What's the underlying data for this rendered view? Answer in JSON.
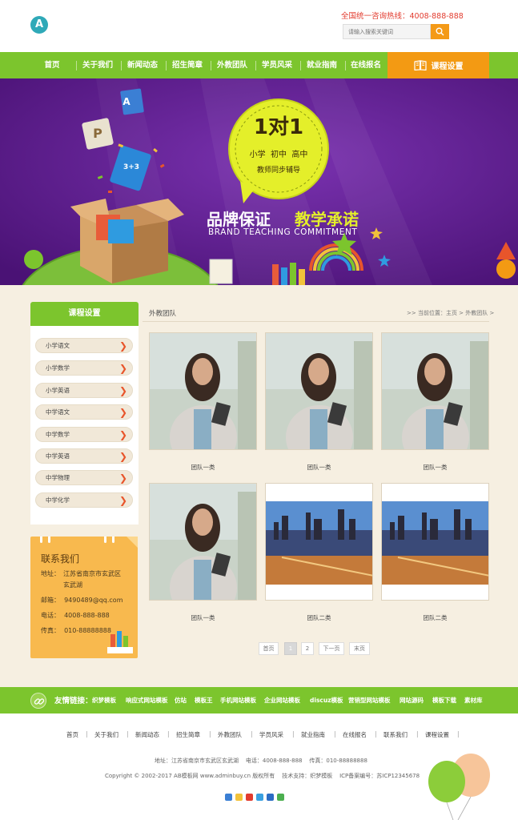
{
  "header": {
    "logo_letter": "A",
    "hotline": "全国统一咨询热线：4008-888-888",
    "search_placeholder": "请输入搜索关键词"
  },
  "nav": {
    "items": [
      "首页",
      "关于我们",
      "新闻动态",
      "招生简章",
      "外教团队",
      "学员风采",
      "就业指南",
      "在线报名"
    ],
    "course": "课程设置"
  },
  "banner": {
    "badge_big": "1对1",
    "badge_levels": "小学  初中  高中",
    "badge_sub": "教师同步辅导",
    "slogan_left": "品牌保证",
    "slogan_right": "教学承诺",
    "slogan_en": "BRAND TEACHING COMMITMENT",
    "book_a": "A",
    "book_p": "P",
    "book_math": "3+3"
  },
  "sidebar": {
    "title": "课程设置",
    "items": [
      "小学语文",
      "小学数学",
      "小学英语",
      "中学语文",
      "中学数学",
      "中学英语",
      "中学物理",
      "中学化学"
    ]
  },
  "contact": {
    "title": "联系我们",
    "address_label": "地址：",
    "address_l1": "江苏省南京市玄武区",
    "address_l2": "玄武湖",
    "email": "邮箱：  9490489@qq.com",
    "phone": "电话：  4008-888-888",
    "fax": "传真：  010-88888888"
  },
  "content": {
    "title": "外教团队",
    "breadcrumb": ">> 当前位置：主页 > 外教团队 >",
    "cards": [
      {
        "caption": "团队一类",
        "image": "teacher-photo"
      },
      {
        "caption": "团队一类",
        "image": "teacher-photo"
      },
      {
        "caption": "团队一类",
        "image": "teacher-photo"
      },
      {
        "caption": "团队一类",
        "image": "teacher-photo"
      },
      {
        "caption": "团队二类",
        "image": "city-photo"
      },
      {
        "caption": "团队二类",
        "image": "city-photo"
      }
    ]
  },
  "pagination": {
    "first": "首页",
    "pages": [
      "1",
      "2"
    ],
    "next": "下一页",
    "last": "末页",
    "current": "1"
  },
  "friend_links": {
    "label": "友情链接：",
    "items": [
      "织梦模板",
      "响应式网站模板",
      "仿站",
      "模板王",
      "手机网站模板",
      "企业网站模板",
      "discuz模板",
      "营销型网站模板",
      "网站源码",
      "模板下载",
      "素材库"
    ]
  },
  "footer": {
    "nav": [
      "首页",
      "关于我们",
      "新闻动态",
      "招生简章",
      "外教团队",
      "学员风采",
      "就业指南",
      "在线报名",
      "联系我们",
      "课程设置"
    ],
    "address": "地址：江苏省南京市玄武区玄武湖    电话：4008-888-888    传真：010-88888888",
    "copyright": "Copyright © 2002-2017 AB模板网 www.adminbuy.cn 版权所有    技术支持：织梦模板    ICP备案编号：苏ICP12345678"
  },
  "colors": {
    "nav_green": "#7cc52d",
    "accent_orange": "#f39a13",
    "hotline_red": "#e23b2e",
    "banner_purple": "#5a1b87"
  }
}
